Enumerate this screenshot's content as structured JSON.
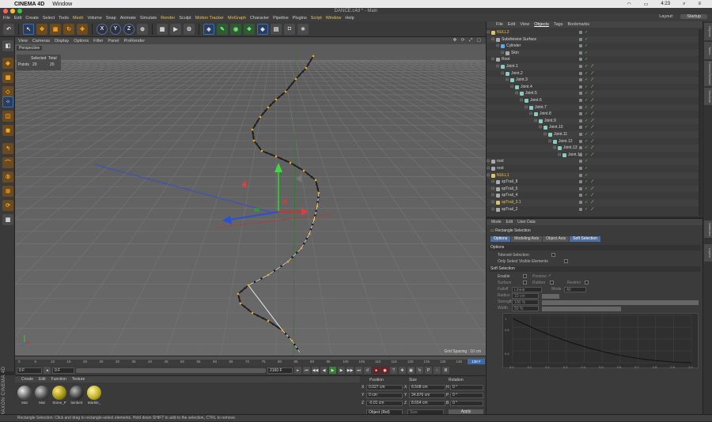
{
  "mac": {
    "app": "CINEMA 4D",
    "window": "Window",
    "time": "4:23"
  },
  "title": "DANCE.c4d * - Main",
  "menus": [
    "File",
    "Edit",
    "Create",
    "Select",
    "Tools",
    "Mesh",
    "Volume",
    "Snap",
    "Animate",
    "Simulate",
    "Render",
    "Sculpt",
    "Motion Tracker",
    "MoGraph",
    "Character",
    "Pipeline",
    "Plugins",
    "Script",
    "Window",
    "Help"
  ],
  "layout": {
    "label": "Layout:",
    "value": "Startup"
  },
  "axis": {
    "x": "X",
    "y": "Y",
    "z": "Z"
  },
  "viewport": {
    "menus": [
      "View",
      "Cameras",
      "Display",
      "Options",
      "Filter",
      "Panel",
      "ProRender"
    ],
    "camera": "Perspective",
    "stats": {
      "selected": "Selected",
      "total": "Total",
      "points": "Points",
      "sel_val": "20",
      "tot_val": "20"
    },
    "grid": "Grid Spacing : 10 cm"
  },
  "timeline": {
    "ticks": [
      "0",
      "5",
      "10",
      "15",
      "20",
      "25",
      "30",
      "35",
      "40",
      "45",
      "50",
      "55",
      "60",
      "65",
      "70",
      "75",
      "80",
      "85",
      "90",
      "95",
      "100",
      "105",
      "110",
      "115",
      "120",
      "125",
      "130",
      "135"
    ],
    "current": "138 F"
  },
  "transport": {
    "start": "0 F",
    "min": "0 F",
    "end": "2160 F"
  },
  "materials": {
    "menu": [
      "Create",
      "Edit",
      "Function",
      "Texture"
    ],
    "items": [
      "Mat",
      "Mat",
      "Stone_P",
      "lambert",
      "Marble_"
    ]
  },
  "coords": {
    "headers": [
      "Position",
      "Size",
      "Rotation"
    ],
    "rows": [
      {
        "axis": "X",
        "pos": "0.027 cm",
        "size": "8.508 cm",
        "rlabel": "H",
        "rot": "0 °"
      },
      {
        "axis": "Y",
        "pos": "0 cm",
        "size": "34.876 cm",
        "rlabel": "P",
        "rot": "0 °"
      },
      {
        "axis": "Z",
        "pos": "-0.01 cm",
        "size": "8.654 cm",
        "rlabel": "B",
        "rot": "0 °"
      }
    ],
    "mode": "Object (Rel)",
    "sizemode": "Size",
    "apply": "Apply"
  },
  "brand": "MAXON CINEMA 4D",
  "status": "Rectangle Selection: Click and drag to rectangle-select elements. Hold down SHIFT to add to the selection, CTRL to remove.",
  "objects": {
    "menu": [
      "File",
      "Edit",
      "View",
      "Objects",
      "Tags",
      "Bookmarks"
    ],
    "items": [
      {
        "name": "NULL2",
        "depth": 0,
        "yellow": true
      },
      {
        "name": "Subdivision Surface",
        "depth": 1,
        "yellow": false
      },
      {
        "name": "Cylinder",
        "depth": 2,
        "yellow": false
      },
      {
        "name": "Skin",
        "depth": 3,
        "yellow": false
      },
      {
        "name": "Root",
        "depth": 1,
        "yellow": false
      },
      {
        "name": "Joint.1",
        "depth": 2,
        "yellow": false
      },
      {
        "name": "Joint.2",
        "depth": 3,
        "yellow": false
      },
      {
        "name": "Joint.3",
        "depth": 4,
        "yellow": false
      },
      {
        "name": "Joint.4",
        "depth": 5,
        "yellow": false
      },
      {
        "name": "Joint.5",
        "depth": 6,
        "yellow": false
      },
      {
        "name": "Joint.6",
        "depth": 7,
        "yellow": false
      },
      {
        "name": "Joint.7",
        "depth": 8,
        "yellow": false
      },
      {
        "name": "Joint.8",
        "depth": 9,
        "yellow": false
      },
      {
        "name": "Joint.9",
        "depth": 10,
        "yellow": false
      },
      {
        "name": "Joint.10",
        "depth": 11,
        "yellow": false
      },
      {
        "name": "Joint.11",
        "depth": 12,
        "yellow": false
      },
      {
        "name": "Joint.12",
        "depth": 13,
        "yellow": false
      },
      {
        "name": "Joint.13",
        "depth": 14,
        "yellow": false
      },
      {
        "name": "Joint.14",
        "depth": 15,
        "yellow": false
      },
      {
        "name": "root",
        "depth": 0,
        "yellow": false
      },
      {
        "name": "root",
        "depth": 0,
        "yellow": false
      },
      {
        "name": "NULL1",
        "depth": 0,
        "yellow": true
      },
      {
        "name": "spTrail_8",
        "depth": 1,
        "yellow": false
      },
      {
        "name": "spTrail_5",
        "depth": 1,
        "yellow": false
      },
      {
        "name": "spTrail_4",
        "depth": 1,
        "yellow": false
      },
      {
        "name": "spTrail_3.1",
        "depth": 1,
        "yellow": true
      },
      {
        "name": "spTrail_2",
        "depth": 1,
        "yellow": false
      }
    ]
  },
  "attributes": {
    "menu": [
      "Mode",
      "Edit",
      "User Data"
    ],
    "mode": "Rectangle Selection",
    "tabs": [
      "Options",
      "Modeling Axis",
      "Object Axis",
      "Soft Selection"
    ],
    "options": {
      "header": "Options",
      "tolerant": "Tolerant Selection",
      "visible": "Only Select Visible Elements"
    },
    "soft": {
      "header": "Soft Selection",
      "enable": "Enable",
      "preview": "Preview",
      "surface": "Surface",
      "rubber": "Rubber",
      "restrict": "Restrict",
      "falloff": "Falloff",
      "falloff_val": "Linear",
      "mode": "Mode",
      "mode_val": "All",
      "radius": "Radius",
      "radius_val": "10 cm",
      "strength": "Strength",
      "strength_val": "100 %",
      "width": "Width",
      "width_val": "50 %"
    },
    "graph": {
      "y": [
        "1",
        "0.8",
        "0.4"
      ],
      "x": [
        "0.0",
        "0.1",
        "0.2",
        "0.3",
        "0.4",
        "0.5",
        "0.6",
        "0.7",
        "0.8",
        "0.9",
        "1.0"
      ]
    }
  },
  "righttabs": [
    "Objects",
    "Takes",
    "Content Browser",
    "Structure",
    "Attributes",
    "Layers"
  ]
}
